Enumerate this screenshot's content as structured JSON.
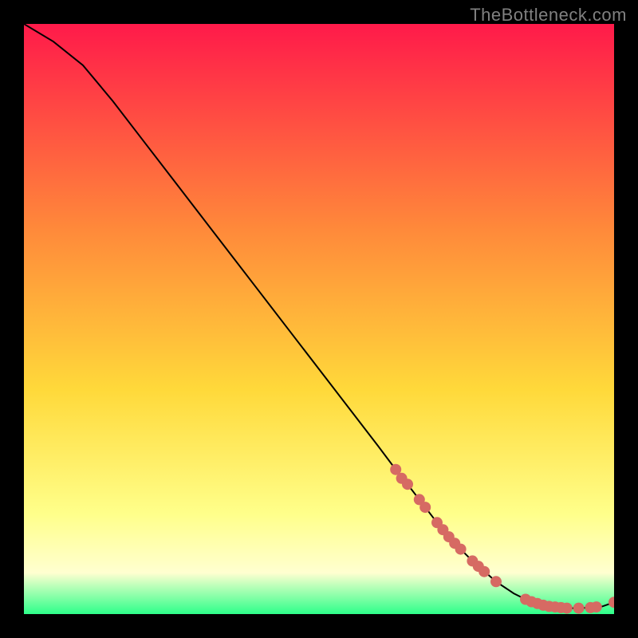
{
  "watermark": "TheBottleneck.com",
  "colors": {
    "gradient_top": "#ff1a4a",
    "gradient_mid1": "#ff6a3a",
    "gradient_mid2": "#ffd93a",
    "gradient_mid3": "#ffff8a",
    "gradient_bottom": "#2eff8a",
    "curve": "#000000",
    "marker": "#d66a63"
  },
  "chart_data": {
    "type": "line",
    "title": "",
    "xlabel": "",
    "ylabel": "",
    "xlim": [
      0,
      100
    ],
    "ylim": [
      0,
      100
    ],
    "series": [
      {
        "name": "curve",
        "x": [
          0,
          5,
          10,
          15,
          20,
          25,
          30,
          35,
          40,
          45,
          50,
          55,
          60,
          63,
          65,
          70,
          73,
          76,
          80,
          83,
          85,
          88,
          90,
          92,
          94,
          96,
          98,
          100
        ],
        "y": [
          100,
          97,
          93,
          87,
          80.5,
          74,
          67.5,
          61,
          54.5,
          48,
          41.5,
          35,
          28.5,
          24.5,
          22,
          15.5,
          12,
          9,
          5.5,
          3.5,
          2.5,
          1.5,
          1.2,
          1.0,
          1.0,
          1.1,
          1.3,
          2.0
        ]
      }
    ],
    "markers": [
      {
        "x": 63,
        "y": 24.5
      },
      {
        "x": 64,
        "y": 23.0
      },
      {
        "x": 65,
        "y": 22.0
      },
      {
        "x": 67,
        "y": 19.4
      },
      {
        "x": 68,
        "y": 18.1
      },
      {
        "x": 70,
        "y": 15.5
      },
      {
        "x": 71,
        "y": 14.3
      },
      {
        "x": 72,
        "y": 13.1
      },
      {
        "x": 73,
        "y": 12.0
      },
      {
        "x": 74,
        "y": 11.0
      },
      {
        "x": 76,
        "y": 9.0
      },
      {
        "x": 77,
        "y": 8.1
      },
      {
        "x": 78,
        "y": 7.2
      },
      {
        "x": 80,
        "y": 5.5
      },
      {
        "x": 85,
        "y": 2.5
      },
      {
        "x": 86,
        "y": 2.1
      },
      {
        "x": 87,
        "y": 1.8
      },
      {
        "x": 88,
        "y": 1.5
      },
      {
        "x": 89,
        "y": 1.3
      },
      {
        "x": 90,
        "y": 1.2
      },
      {
        "x": 91,
        "y": 1.1
      },
      {
        "x": 92,
        "y": 1.0
      },
      {
        "x": 94,
        "y": 1.0
      },
      {
        "x": 96,
        "y": 1.1
      },
      {
        "x": 97,
        "y": 1.2
      },
      {
        "x": 100,
        "y": 2.0
      }
    ]
  }
}
